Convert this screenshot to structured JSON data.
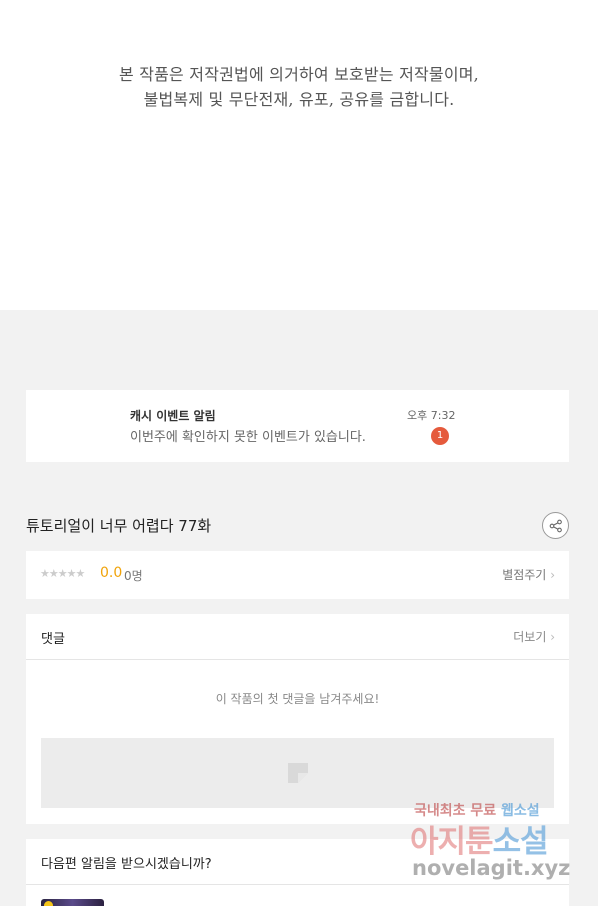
{
  "notice": {
    "line1": "본 작품은 저작권법에 의거하여 보호받는 저작물이며,",
    "line2": "불법복제 및 무단전재, 유포, 공유를 금합니다."
  },
  "push": {
    "title": "캐시 이벤트 알림",
    "message": "이번주에 확인하지 못한 이벤트가 있습니다.",
    "time": "오후 7:32",
    "badge": "1",
    "badge_color": "#e55a3c"
  },
  "episode": {
    "title": "튜토리얼이 너무 어렵다 77화",
    "share_icon": "share-icon"
  },
  "rating": {
    "stars": "★★★★★",
    "score": "0.0",
    "count": "0명",
    "rate_label": "별점주기",
    "accent": "#f0a30a"
  },
  "comments": {
    "title": "댓글",
    "more_label": "더보기",
    "empty_message": "이 작품의 첫 댓글을 남겨주세요!"
  },
  "next_alert": {
    "title": "다음편 알림을 받으시겠습니까?"
  },
  "watermark": {
    "top_a": "국내최초 무료",
    "top_b": "웹소설",
    "mid_a": "아지툰",
    "mid_b": "소설",
    "bottom": "novelagit.xyz"
  }
}
